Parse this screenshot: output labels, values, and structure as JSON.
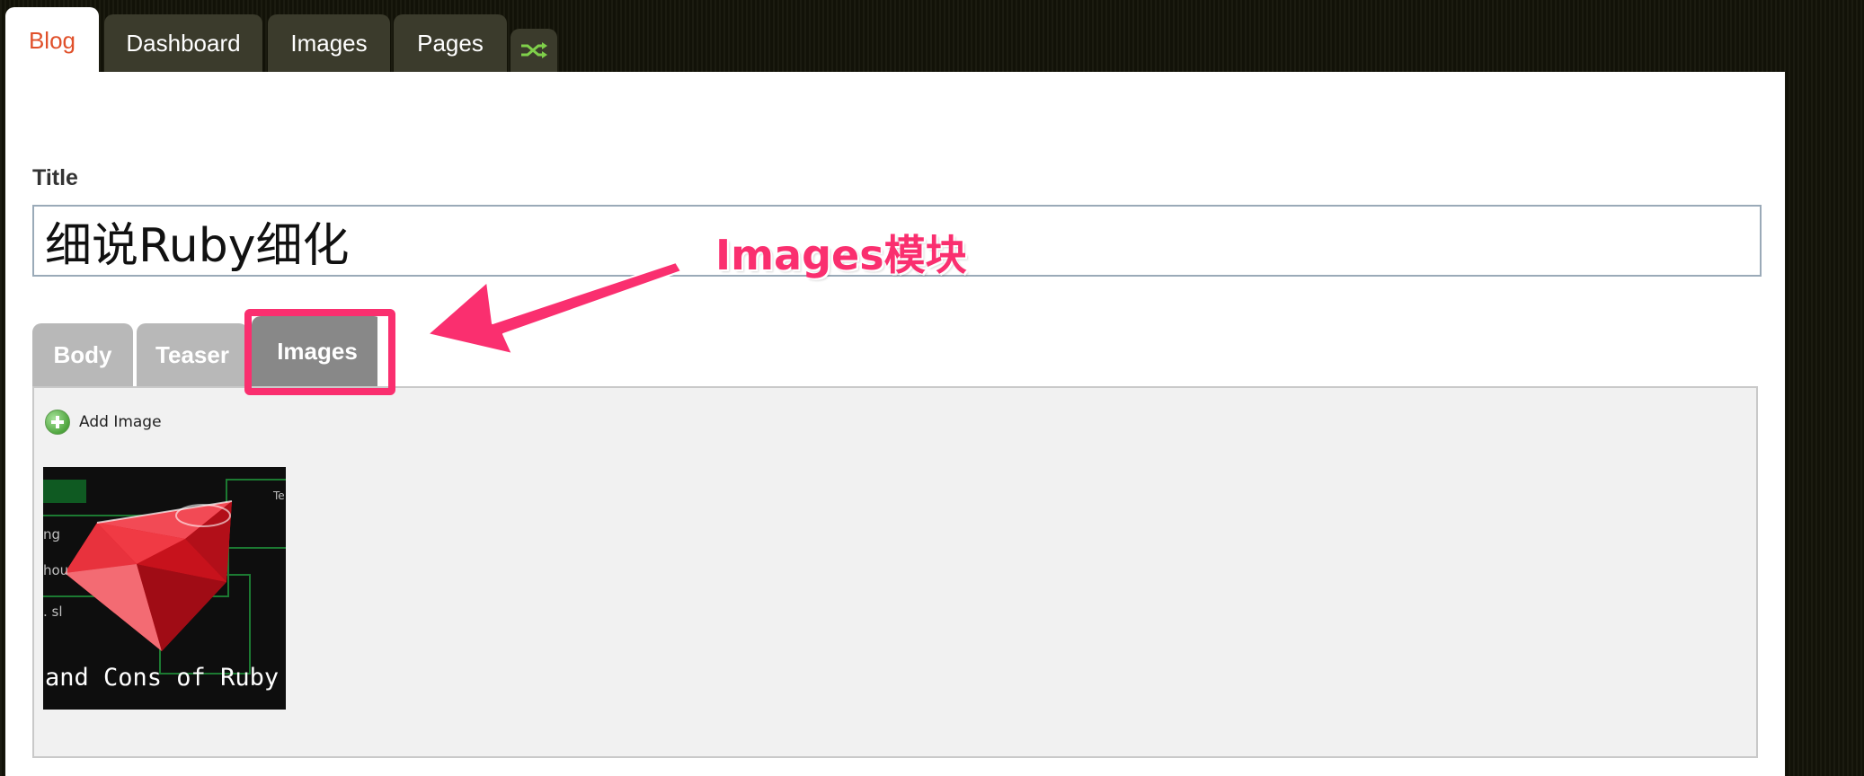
{
  "top_nav": {
    "tabs": [
      {
        "label": "Blog",
        "active": true
      },
      {
        "label": "Dashboard",
        "active": false
      },
      {
        "label": "Images",
        "active": false
      },
      {
        "label": "Pages",
        "active": false
      }
    ],
    "switch_icon": "shuffle-icon"
  },
  "form": {
    "title_label": "Title",
    "title_value": "细说Ruby细化"
  },
  "sub_tabs": [
    {
      "label": "Body",
      "selected": false
    },
    {
      "label": "Teaser",
      "selected": false
    },
    {
      "label": "Images",
      "selected": true
    }
  ],
  "images_panel": {
    "add_label": "Add Image",
    "add_icon": "plus-circle-icon",
    "thumbnail_caption": "and Cons of Ruby Re",
    "thumbnail_side_texts": [
      "ng",
      "hou",
      ". sl",
      "Te"
    ]
  },
  "annotation": {
    "text": "Images模块",
    "color": "#fa2f6f"
  },
  "colors": {
    "active_tab_text": "#e0502a",
    "tab_bg": "#3b3b2c",
    "selected_subtab_bg": "#888888",
    "subtab_bg": "#b8b8b8"
  }
}
